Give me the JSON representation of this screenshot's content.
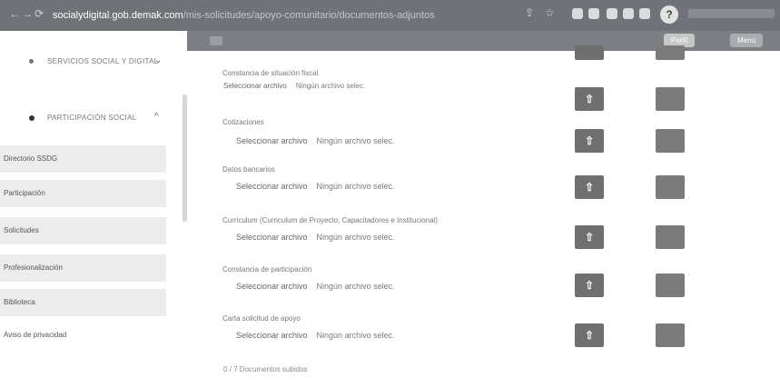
{
  "browser": {
    "url_host": "socialydigital.gob.demak.com",
    "url_path": "/mis-solicitudes/apoyo-comunitario/documentos-adjuntos",
    "profile_initial": "?"
  },
  "sidebar": {
    "groups": [
      {
        "label": "Servicios social y digital",
        "chevron": "⌄"
      },
      {
        "label": "Participación social",
        "chevron": "^"
      }
    ],
    "items": [
      {
        "label": "Directorio SSDG"
      },
      {
        "label": "Participación"
      },
      {
        "label": "Solicitudes"
      },
      {
        "label": "Profesionalización"
      },
      {
        "label": "Biblioteca"
      }
    ],
    "footer_link": "Aviso de privacidad"
  },
  "topbar": {
    "user_button": "Perfil",
    "menu_button": "Menú"
  },
  "main": {
    "sections": [
      {
        "title": "Constancia de situación fiscal",
        "pick_label": "Seleccionar archivo",
        "status": "Ningún archivo selec."
      },
      {
        "title": "Cotizaciones",
        "pick_label": "Seleccionar archivo",
        "status": "Ningún archivo selec."
      },
      {
        "title": "Datos bancarios",
        "pick_label": "Seleccionar archivo",
        "status": "Ningún archivo selec."
      },
      {
        "title": "Curriculum (Curriculum de Proyecto, Capacitadores e Institucional)",
        "pick_label": "Seleccionar archivo",
        "status": "Ningún archivo selec."
      },
      {
        "title": "Constancia de participación",
        "pick_label": "Seleccionar archivo",
        "status": "Ningún archivo selec."
      },
      {
        "title": "Carta solicitud de apoyo",
        "pick_label": "Seleccionar archivo",
        "status": "Ningún archivo selec."
      }
    ],
    "upload_icon": "⇧",
    "footer": "0 / 7 Documentos subidos"
  }
}
